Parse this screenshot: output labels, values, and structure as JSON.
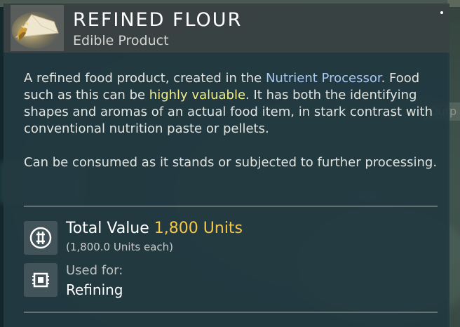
{
  "item": {
    "name": "REFINED FLOUR",
    "category": "Edible Product",
    "icon": "flour-pile-icon"
  },
  "description": {
    "p1_a": "A refined food product, created in the ",
    "p1_link": "Nutrient Processor",
    "p1_b": ". Food such as this can be ",
    "p1_highlight": "highly valuable",
    "p1_c": ". It has both the identifying shapes and aromas of an actual food item, in stark contrast with conventional nutrition paste or pellets.",
    "p2": "Can be consumed as it stands or subjected to further processing."
  },
  "value": {
    "label": "Total Value",
    "amount": "1,800 Units",
    "each": "(1,800.0 Units each)",
    "icon": "units-currency-icon"
  },
  "usage": {
    "label": "Used for:",
    "value": "Refining",
    "icon": "refiner-chip-icon"
  },
  "background": {
    "edge_label": "Outp"
  },
  "colors": {
    "link_blue": "#a9c8f0",
    "highlight_yellow": "#f2ee8a",
    "units_gold": "#f6c84a"
  }
}
